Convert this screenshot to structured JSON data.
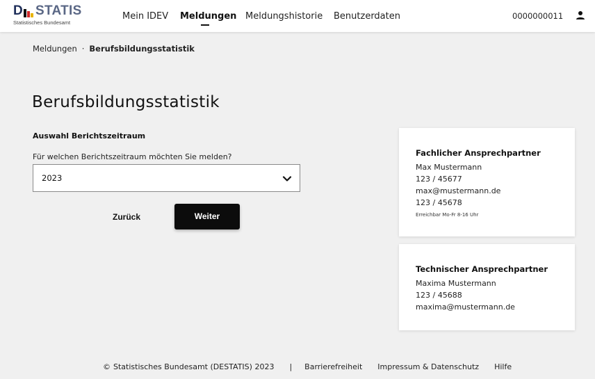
{
  "brand": {
    "logo_d": "D",
    "logo_statis": "STATIS",
    "logo_subtitle": "Statistisches Bundesamt",
    "colors": {
      "navy": "#1f2f5a",
      "bar_black": "#111111",
      "bar_red": "#d12a2a",
      "bar_gold": "#e8b400"
    }
  },
  "nav": {
    "items": [
      "Mein IDEV",
      "Meldungen",
      "Meldungshistorie",
      "Benutzerdaten"
    ],
    "active": "Meldungen"
  },
  "user": {
    "id": "0000000011",
    "icon": "user-icon"
  },
  "breadcrumb": {
    "parent": "Meldungen",
    "separator": "·",
    "current": "Berufsbildungsstatistik"
  },
  "page": {
    "title": "Berufsbildungsstatistik",
    "section_label": "Auswahl Berichtszeitraum",
    "field_label": "Für welchen Berichtszeitraum möchten Sie melden?",
    "selected_period": "2023",
    "back_label": "Zurück",
    "next_label": "Weiter"
  },
  "contacts": [
    {
      "title": "Fachlicher Ansprechpartner",
      "name": "Max Mustermann",
      "phone": "123 / 45677",
      "email": "max@mustermann.de",
      "fax": "123 / 45678",
      "availability": "Erreichbar Mo-Fr 8-16 Uhr"
    },
    {
      "title": "Technischer Ansprechpartner",
      "name": "Maxima Mustermann",
      "phone": "123 / 45688",
      "email": "maxima@mustermann.de"
    }
  ],
  "footer": {
    "copyright": "Statistisches Bundesamt (DESTATIS) 2023",
    "copyright_symbol": "©",
    "divider": "|",
    "links": [
      "Barrierefreiheit",
      "Impressum & Datenschutz",
      "Hilfe"
    ]
  }
}
